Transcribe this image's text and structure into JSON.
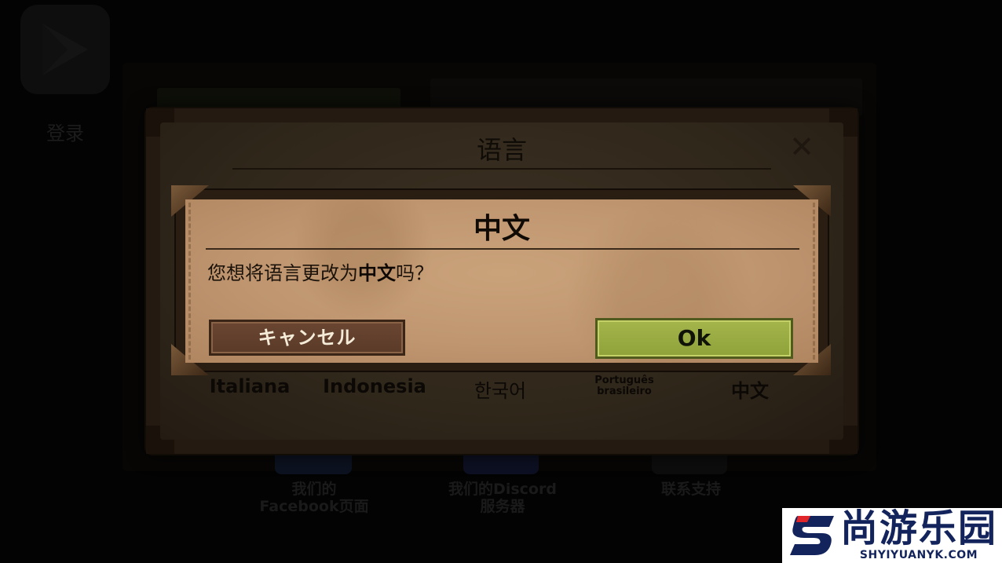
{
  "background": {
    "login_label": "登录",
    "footer": [
      {
        "label": "我们的Facebook页面"
      },
      {
        "label": "我们的Discord服务器"
      },
      {
        "label": "联系支持"
      }
    ]
  },
  "language_dialog": {
    "title": "语言",
    "close_icon": "close-icon",
    "options": [
      {
        "label": "Italiana"
      },
      {
        "label": "Indonesia"
      },
      {
        "label": "한국어"
      },
      {
        "label": "Português brasileiro"
      },
      {
        "label": "中文"
      }
    ]
  },
  "confirm_dialog": {
    "title": "中文",
    "message_prefix": "您想将语言更改为",
    "message_language": "中文",
    "message_suffix": "吗？",
    "cancel_label": "キャンセル",
    "ok_label": "Ok"
  },
  "watermark": {
    "name": "尚游乐园",
    "url": "SHYIYUANYK.COM"
  },
  "colors": {
    "ok_button": "#9aad45",
    "cancel_button": "#5f3e2c",
    "paper": "#c39a73",
    "watermark_blue": "#13245c",
    "watermark_red": "#e0262b"
  }
}
